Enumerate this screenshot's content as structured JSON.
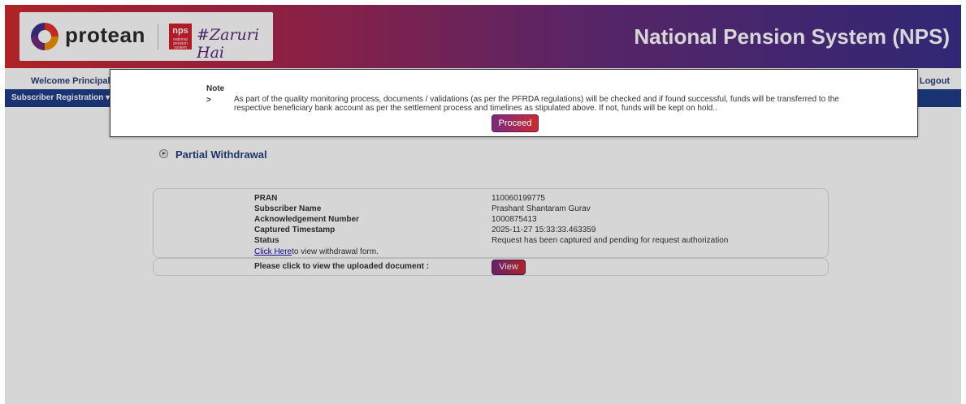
{
  "header": {
    "logo_text": "protean",
    "nps_badge": "nps",
    "nps_badge_sub": "national pension system",
    "tagline": "#Zaruri Hai",
    "title": "National Pension System (NPS)"
  },
  "welcome": {
    "text": "Welcome Principal Ac",
    "logout": "| Logout"
  },
  "menu": {
    "item": "Subscriber Registration ▾"
  },
  "section": {
    "title": "Partial Withdrawal"
  },
  "details": {
    "rows": [
      {
        "label": "PRAN",
        "value": "110060199775"
      },
      {
        "label": "Subscriber Name",
        "value": "Prashant Shantaram Gurav"
      },
      {
        "label": "Acknowledgement Number",
        "value": "1000875413"
      },
      {
        "label": "Captured Timestamp",
        "value": "2025-11-27 15:33:33.463359"
      },
      {
        "label": "Status",
        "value": "Request has been captured and pending for request authorization"
      }
    ],
    "click_link": "Click Here",
    "click_suffix": "to view withdrawal form.",
    "view_label": "Please click to view the uploaded document :",
    "view_button": "View"
  },
  "note": {
    "title": "Note",
    "arrow": ">",
    "text": "As part of the quality monitoring process, documents / validations (as per the PFRDA regulations) will be checked and if found successful, funds will be transferred to the respective beneficiary bank account as per the settlement process and timelines as stipulated above. If not, funds will be kept on hold..",
    "proceed_button": "Proceed"
  },
  "colors": {
    "header_start": "#cf2a2f",
    "header_end": "#3b2f8c",
    "menu_bar": "#1f3f8a",
    "button_start": "#7a2a7e",
    "button_end": "#cf2a2f"
  }
}
